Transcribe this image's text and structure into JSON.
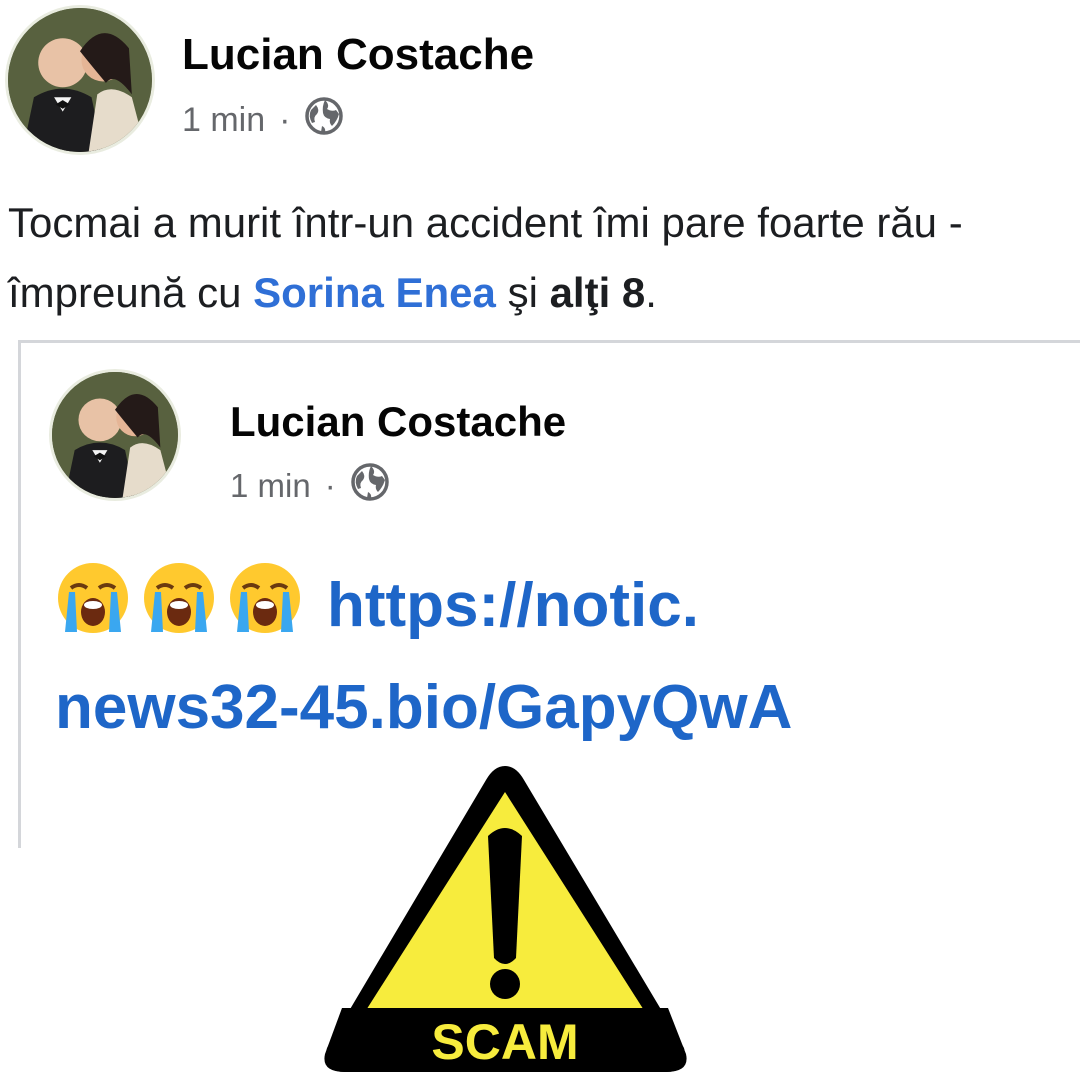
{
  "post": {
    "author": "Lucian Costache",
    "time": "1 min",
    "separator": "·",
    "privacy_icon": "globe-icon",
    "text_part1": "Tocmai a murit într-un accident îmi pare foarte rău - împreună cu ",
    "mention": "Sorina Enea",
    "text_part2": " şi ",
    "others": "alţi 8",
    "text_end": "."
  },
  "shared_post": {
    "author": "Lucian Costache",
    "time": "1 min",
    "separator": "·",
    "privacy_icon": "globe-icon",
    "emojis": [
      "loudly-crying-face",
      "loudly-crying-face",
      "loudly-crying-face"
    ],
    "link_line1": "https://notic.",
    "link_line2": "news32-45.bio/GapyQwA"
  },
  "warning": {
    "icon": "warning-triangle-icon",
    "label": "SCAM",
    "colors": {
      "fill": "#f7ec3d",
      "outline": "#000000",
      "label": "#f7ec3d"
    }
  },
  "colors": {
    "mention": "#2f6fd6",
    "link": "#1e66c8",
    "meta": "#65676b"
  }
}
